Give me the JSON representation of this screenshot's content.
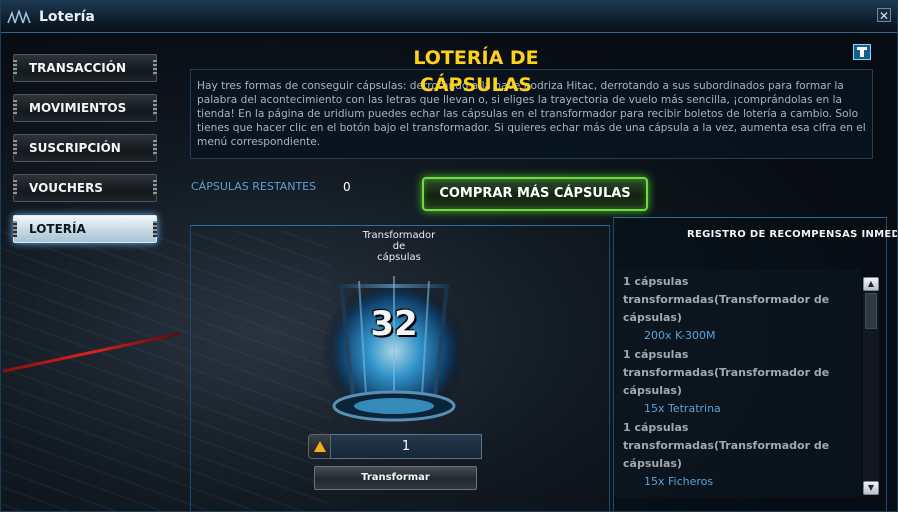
{
  "window": {
    "title": "Lotería",
    "close_symbol": "✕"
  },
  "sidebar": {
    "items": [
      {
        "label": "TRANSACCIÓN"
      },
      {
        "label": "MOVIMIENTOS"
      },
      {
        "label": "SUSCRIPCIÓN"
      },
      {
        "label": "VOUCHERS"
      },
      {
        "label": "LOTERÍA",
        "active": true
      }
    ]
  },
  "main": {
    "title_line1": "LOTERÍA DE",
    "title_line2": "CÁPSULAS",
    "info_icon": "info-icon",
    "description": "Hay tres formas de conseguir cápsulas: derrotando a la nave nodriza Hitac, derrotando a sus subordinados para formar la palabra del acontecimiento con las letras que llevan o, si eliges la trayectoria de vuelo más sencilla, ¡comprándolas en la tienda! En la página de uridium puedes echar las cápsulas en el transformador para recibir boletos de lotería a cambio. Solo tienes que hacer clic en el botón bajo el transformador. Si quieres echar más de una cápsula a la vez, aumenta esa cifra en el menú correspondiente.",
    "capsules_label": "CÁPSULAS RESTANTES",
    "capsules_count": "0",
    "buy_button": "COMPRAR MÁS CÁPSULAS"
  },
  "transformer": {
    "label_line1": "Transformador",
    "label_line2": "de",
    "label_line3": "cápsulas",
    "counter": "32",
    "quantity": "1",
    "transform_button": "Transformar"
  },
  "reward_log": {
    "title": "REGISTRO DE RECOMPENSAS INMED",
    "entries": [
      {
        "desc": "1 cápsulas transformadas(Transformador de cápsulas)",
        "reward": "200x K-300M"
      },
      {
        "desc": "1 cápsulas transformadas(Transformador de cápsulas)",
        "reward": "15x Tetratrina"
      },
      {
        "desc": "1 cápsulas transformadas(Transformador de cápsulas)",
        "reward": "15x Ficheros"
      }
    ]
  },
  "colors": {
    "accent_gold": "#ffd21a",
    "accent_green": "#6edc3f",
    "link_blue": "#5da1d8"
  }
}
